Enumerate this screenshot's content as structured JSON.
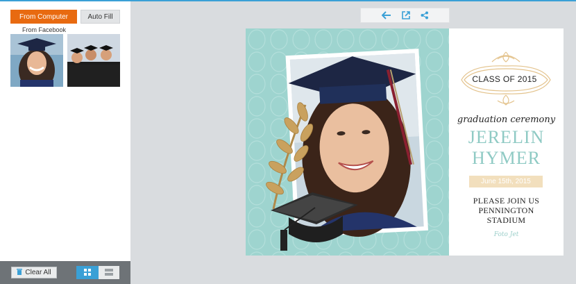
{
  "photos_panel": {
    "from_computer_label": "From Computer",
    "auto_fill_label": "Auto Fill",
    "from_facebook_label": "From Facebook"
  },
  "bottom_bar": {
    "clear_all_label": "Clear All"
  },
  "toolbar": {
    "icons": [
      "back-arrow-icon",
      "external-link-icon",
      "share-icon"
    ]
  },
  "card": {
    "class_of": "CLASS OF 2015",
    "event_title": "graduation ceremony",
    "first_name": "JERELIN",
    "last_name": "HYMER",
    "date": "June 15th, 2015",
    "line1": "PLEASE JOIN US",
    "line2": "PENNINGTON",
    "line3": "STADIUM",
    "brand": "Foto Jet"
  },
  "colors": {
    "accent_orange": "#e86a10",
    "accent_blue": "#3aa0d6",
    "card_teal": "#9ed4cf",
    "name_teal": "#8fcac4",
    "ribbon_gold": "#f2dfbd"
  }
}
